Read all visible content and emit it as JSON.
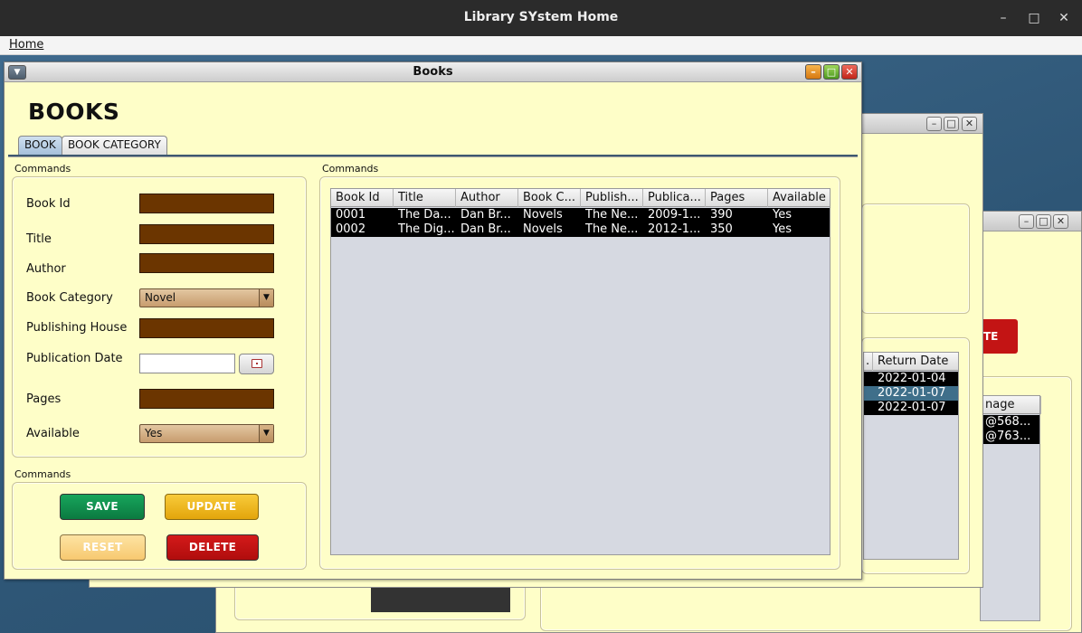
{
  "os": {
    "title": "Library SYstem Home",
    "min": "–",
    "max": "□",
    "close": "✕"
  },
  "menu": {
    "home": "Home"
  },
  "books": {
    "title": "Books",
    "heading": "BOOKS",
    "tabs": [
      "BOOK",
      "BOOK CATEGORY"
    ],
    "form_section": "Commands",
    "table_section": "Commands",
    "buttons_section": "Commands",
    "fields": {
      "book_id": "Book Id",
      "title": "Title",
      "author": "Author",
      "book_category": "Book Category",
      "publishing_house": "Publishing House",
      "publication_date": "Publication Date",
      "pages": "Pages",
      "available": "Available"
    },
    "category_value": "Novel",
    "available_value": "Yes",
    "buttons": {
      "save": "SAVE",
      "update": "UPDATE",
      "reset": "RESET",
      "delete": "DELETE"
    },
    "table": {
      "headers": [
        "Book Id",
        "Title",
        "Author",
        "Book C...",
        "Publish...",
        "Publica...",
        "Pages",
        "Available"
      ],
      "rows": [
        [
          "0001",
          "The Da...",
          "Dan Br...",
          "Novels",
          "The Ne...",
          "2009-1...",
          "390",
          "Yes"
        ],
        [
          "0002",
          "The Dig...",
          "Dan Br...",
          "Novels",
          "The Ne...",
          "2012-1...",
          "350",
          "Yes"
        ]
      ]
    }
  },
  "bg_loans": {
    "header_fragment": ".",
    "header": "Return Date",
    "rows": [
      "2022-01-04",
      "2022-01-07",
      "2022-01-07"
    ]
  },
  "bg_members": {
    "button_fragment": "TE",
    "header": "nage",
    "rows": [
      "@568...",
      "@763..."
    ]
  }
}
